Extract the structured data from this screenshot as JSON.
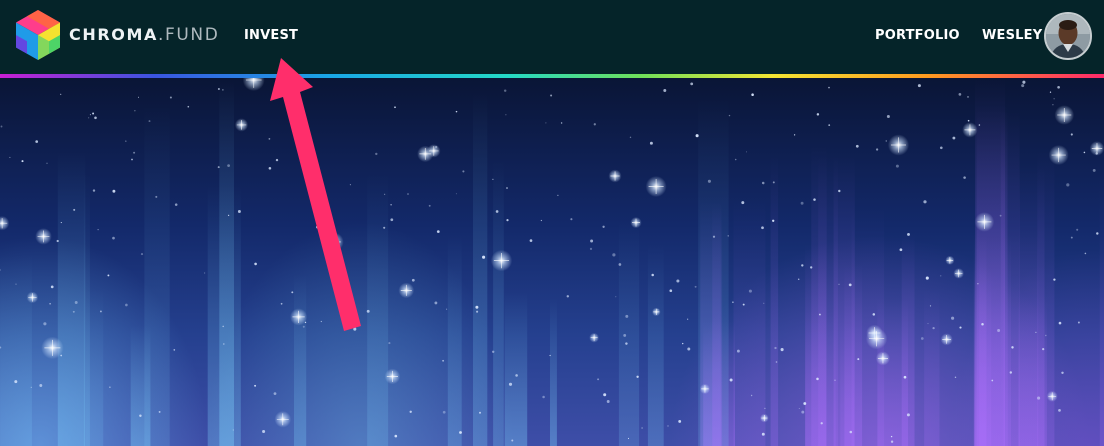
{
  "brand": {
    "name_bold": "CHROMA",
    "name_sep": ".",
    "name_light": "FUND",
    "logo_icon": "cube-logo-icon"
  },
  "nav": {
    "invest": "INVEST",
    "portfolio": "PORTFOLIO",
    "user": "WESLEY"
  },
  "colors": {
    "header_bg": "#052429",
    "arrow": "#ff2e6b",
    "rainbow": [
      "#c81fd3",
      "#19a7e6",
      "#24d9c6",
      "#f3e533",
      "#ff2a6a"
    ]
  }
}
